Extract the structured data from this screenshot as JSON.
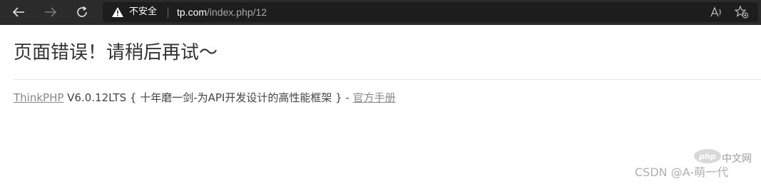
{
  "browser": {
    "security_label": "不安全",
    "url_domain": "tp.com",
    "url_path": "/index.php/12"
  },
  "page": {
    "title": "页面错误！请稍后再试～",
    "framework_link": "ThinkPHP",
    "version_text": " V6.0.12LTS { 十年磨一剑-为API开发设计的高性能框架 } - ",
    "manual_link": "官方手册"
  },
  "watermark": {
    "text": "CSDN @A-萌一代",
    "logo_text": "php",
    "logo_suffix": "中文网"
  }
}
